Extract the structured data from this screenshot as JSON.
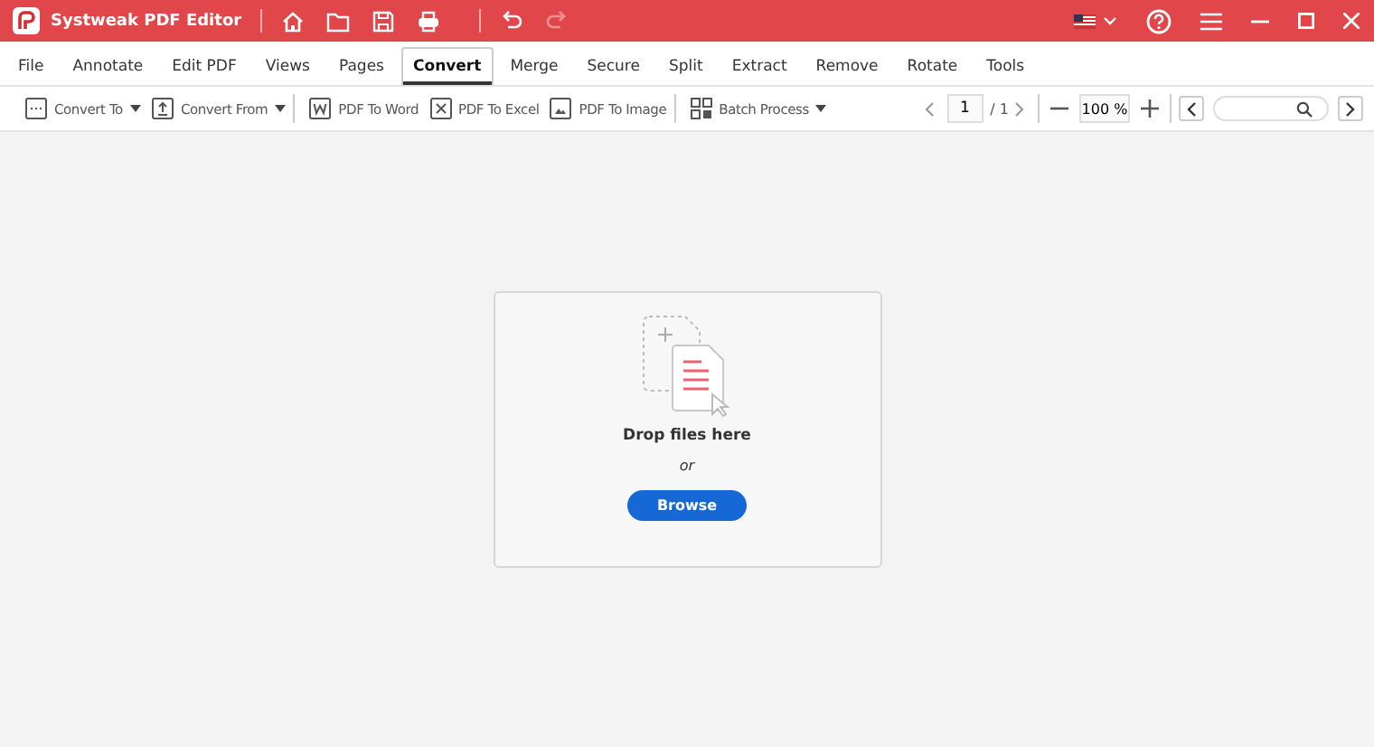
{
  "window": {
    "title": "Systweak PDF Editor"
  },
  "quick_actions": [
    {
      "kind": "home",
      "disabled": false
    },
    {
      "kind": "folder",
      "disabled": false
    },
    {
      "kind": "save",
      "disabled": false
    },
    {
      "kind": "print",
      "disabled": false
    },
    {
      "kind": "undo",
      "disabled": false
    },
    {
      "kind": "redo",
      "disabled": true
    }
  ],
  "tabs": [
    {
      "label": "File",
      "selected": false
    },
    {
      "label": "Annotate",
      "selected": false
    },
    {
      "label": "Edit PDF",
      "selected": false
    },
    {
      "label": "Views",
      "selected": false
    },
    {
      "label": "Pages",
      "selected": false
    },
    {
      "label": "Convert",
      "selected": true
    },
    {
      "label": "Merge",
      "selected": false
    },
    {
      "label": "Secure",
      "selected": false
    },
    {
      "label": "Split",
      "selected": false
    },
    {
      "label": "Extract",
      "selected": false
    },
    {
      "label": "Remove",
      "selected": false
    },
    {
      "label": "Rotate",
      "selected": false
    },
    {
      "label": "Tools",
      "selected": false
    }
  ],
  "toolbar": [
    {
      "label": "Convert To",
      "dropdown": true
    },
    {
      "label": "Convert From",
      "dropdown": true
    },
    {
      "label": "PDF To Word",
      "dropdown": false
    },
    {
      "label": "PDF To Excel",
      "dropdown": false
    },
    {
      "label": "PDF To Image",
      "dropdown": false
    },
    {
      "label": "Batch Process",
      "dropdown": true
    }
  ],
  "page_nav": {
    "page": "1",
    "total": "/ 1"
  },
  "zoom": {
    "value": "100 %"
  },
  "drop_zone": {
    "title": "Drop files here",
    "separator": "or",
    "button": "Browse"
  }
}
